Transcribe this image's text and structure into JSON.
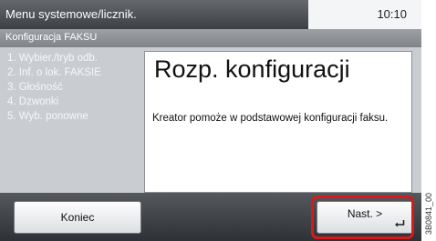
{
  "header": {
    "title": "Menu systemowe/licznik.",
    "time": "10:10"
  },
  "subheader": {
    "title": "Konfiguracja FAKSU"
  },
  "steps": [
    "1. Wybier./tryb odb.",
    "2. Inf. o lok. FAKSIE",
    "3. Głośność",
    "4. Dzwonki",
    "5. Wyb. ponowne"
  ],
  "panel": {
    "title": "Rozp. konfiguracji",
    "description": "Kreator pomoże w podstawowej konfiguracji faksu."
  },
  "buttons": {
    "cancel": "Koniec",
    "next": "Nast. >"
  },
  "icons": {
    "enter": "enter-return-icon"
  },
  "colors": {
    "highlight": "#d8191c"
  },
  "figure_code": "3B0841_00"
}
